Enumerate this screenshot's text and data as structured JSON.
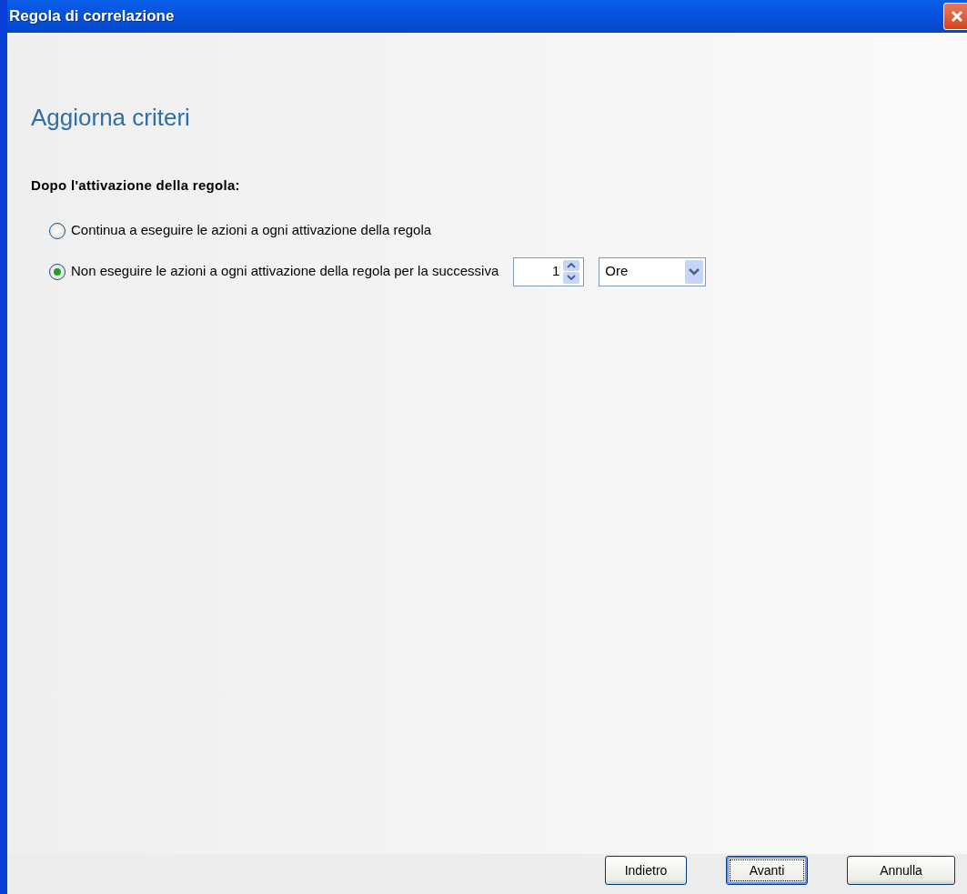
{
  "window": {
    "title": "Regola di correlazione"
  },
  "heading": "Aggiorna criteri",
  "section_label": "Dopo l'attivazione della regola:",
  "options": [
    {
      "label": "Continua a eseguire le azioni a ogni attivazione della regola",
      "selected": false
    },
    {
      "label": "Non eseguire le azioni a ogni attivazione della regola per la successiva",
      "selected": true,
      "spinner": {
        "value": "1"
      },
      "dropdown": {
        "value": "Ore"
      }
    }
  ],
  "buttons": [
    {
      "label": "Indietro",
      "focused": false
    },
    {
      "label": "Avanti",
      "focused": true
    },
    {
      "label": "Annulla",
      "focused": false
    }
  ]
}
